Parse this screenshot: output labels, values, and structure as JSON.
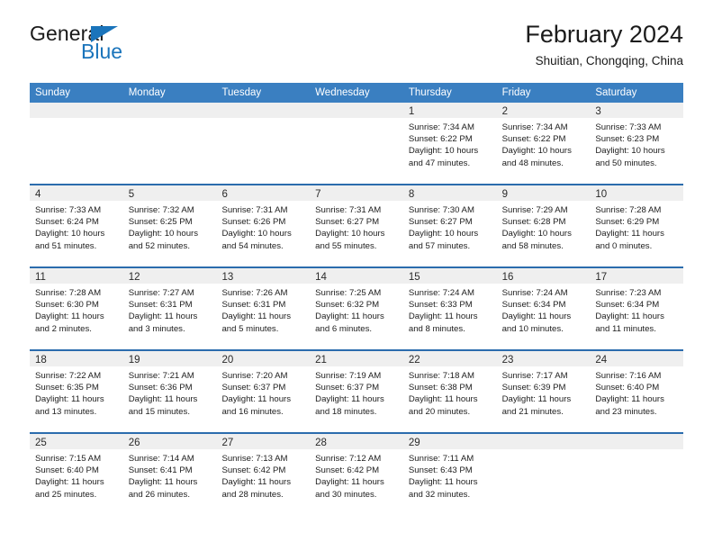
{
  "brand": {
    "name_top": "General",
    "name_bottom": "Blue",
    "triangle_color": "#1a74bb",
    "text_color": "#1a1a1a"
  },
  "header": {
    "title": "February 2024",
    "subtitle": "Shuitian, Chongqing, China"
  },
  "theme": {
    "header_blue": "#3a7fc1",
    "row_border_blue": "#2b6cad",
    "day_band_gray": "#efefef",
    "text_dark": "#1d1d1d"
  },
  "weekdays": [
    "Sunday",
    "Monday",
    "Tuesday",
    "Wednesday",
    "Thursday",
    "Friday",
    "Saturday"
  ],
  "weeks": [
    [
      {
        "day": "",
        "sunrise": "",
        "sunset": "",
        "daylight": "",
        "daylight2": ""
      },
      {
        "day": "",
        "sunrise": "",
        "sunset": "",
        "daylight": "",
        "daylight2": ""
      },
      {
        "day": "",
        "sunrise": "",
        "sunset": "",
        "daylight": "",
        "daylight2": ""
      },
      {
        "day": "",
        "sunrise": "",
        "sunset": "",
        "daylight": "",
        "daylight2": ""
      },
      {
        "day": "1",
        "sunrise": "Sunrise: 7:34 AM",
        "sunset": "Sunset: 6:22 PM",
        "daylight": "Daylight: 10 hours",
        "daylight2": "and 47 minutes."
      },
      {
        "day": "2",
        "sunrise": "Sunrise: 7:34 AM",
        "sunset": "Sunset: 6:22 PM",
        "daylight": "Daylight: 10 hours",
        "daylight2": "and 48 minutes."
      },
      {
        "day": "3",
        "sunrise": "Sunrise: 7:33 AM",
        "sunset": "Sunset: 6:23 PM",
        "daylight": "Daylight: 10 hours",
        "daylight2": "and 50 minutes."
      }
    ],
    [
      {
        "day": "4",
        "sunrise": "Sunrise: 7:33 AM",
        "sunset": "Sunset: 6:24 PM",
        "daylight": "Daylight: 10 hours",
        "daylight2": "and 51 minutes."
      },
      {
        "day": "5",
        "sunrise": "Sunrise: 7:32 AM",
        "sunset": "Sunset: 6:25 PM",
        "daylight": "Daylight: 10 hours",
        "daylight2": "and 52 minutes."
      },
      {
        "day": "6",
        "sunrise": "Sunrise: 7:31 AM",
        "sunset": "Sunset: 6:26 PM",
        "daylight": "Daylight: 10 hours",
        "daylight2": "and 54 minutes."
      },
      {
        "day": "7",
        "sunrise": "Sunrise: 7:31 AM",
        "sunset": "Sunset: 6:27 PM",
        "daylight": "Daylight: 10 hours",
        "daylight2": "and 55 minutes."
      },
      {
        "day": "8",
        "sunrise": "Sunrise: 7:30 AM",
        "sunset": "Sunset: 6:27 PM",
        "daylight": "Daylight: 10 hours",
        "daylight2": "and 57 minutes."
      },
      {
        "day": "9",
        "sunrise": "Sunrise: 7:29 AM",
        "sunset": "Sunset: 6:28 PM",
        "daylight": "Daylight: 10 hours",
        "daylight2": "and 58 minutes."
      },
      {
        "day": "10",
        "sunrise": "Sunrise: 7:28 AM",
        "sunset": "Sunset: 6:29 PM",
        "daylight": "Daylight: 11 hours",
        "daylight2": "and 0 minutes."
      }
    ],
    [
      {
        "day": "11",
        "sunrise": "Sunrise: 7:28 AM",
        "sunset": "Sunset: 6:30 PM",
        "daylight": "Daylight: 11 hours",
        "daylight2": "and 2 minutes."
      },
      {
        "day": "12",
        "sunrise": "Sunrise: 7:27 AM",
        "sunset": "Sunset: 6:31 PM",
        "daylight": "Daylight: 11 hours",
        "daylight2": "and 3 minutes."
      },
      {
        "day": "13",
        "sunrise": "Sunrise: 7:26 AM",
        "sunset": "Sunset: 6:31 PM",
        "daylight": "Daylight: 11 hours",
        "daylight2": "and 5 minutes."
      },
      {
        "day": "14",
        "sunrise": "Sunrise: 7:25 AM",
        "sunset": "Sunset: 6:32 PM",
        "daylight": "Daylight: 11 hours",
        "daylight2": "and 6 minutes."
      },
      {
        "day": "15",
        "sunrise": "Sunrise: 7:24 AM",
        "sunset": "Sunset: 6:33 PM",
        "daylight": "Daylight: 11 hours",
        "daylight2": "and 8 minutes."
      },
      {
        "day": "16",
        "sunrise": "Sunrise: 7:24 AM",
        "sunset": "Sunset: 6:34 PM",
        "daylight": "Daylight: 11 hours",
        "daylight2": "and 10 minutes."
      },
      {
        "day": "17",
        "sunrise": "Sunrise: 7:23 AM",
        "sunset": "Sunset: 6:34 PM",
        "daylight": "Daylight: 11 hours",
        "daylight2": "and 11 minutes."
      }
    ],
    [
      {
        "day": "18",
        "sunrise": "Sunrise: 7:22 AM",
        "sunset": "Sunset: 6:35 PM",
        "daylight": "Daylight: 11 hours",
        "daylight2": "and 13 minutes."
      },
      {
        "day": "19",
        "sunrise": "Sunrise: 7:21 AM",
        "sunset": "Sunset: 6:36 PM",
        "daylight": "Daylight: 11 hours",
        "daylight2": "and 15 minutes."
      },
      {
        "day": "20",
        "sunrise": "Sunrise: 7:20 AM",
        "sunset": "Sunset: 6:37 PM",
        "daylight": "Daylight: 11 hours",
        "daylight2": "and 16 minutes."
      },
      {
        "day": "21",
        "sunrise": "Sunrise: 7:19 AM",
        "sunset": "Sunset: 6:37 PM",
        "daylight": "Daylight: 11 hours",
        "daylight2": "and 18 minutes."
      },
      {
        "day": "22",
        "sunrise": "Sunrise: 7:18 AM",
        "sunset": "Sunset: 6:38 PM",
        "daylight": "Daylight: 11 hours",
        "daylight2": "and 20 minutes."
      },
      {
        "day": "23",
        "sunrise": "Sunrise: 7:17 AM",
        "sunset": "Sunset: 6:39 PM",
        "daylight": "Daylight: 11 hours",
        "daylight2": "and 21 minutes."
      },
      {
        "day": "24",
        "sunrise": "Sunrise: 7:16 AM",
        "sunset": "Sunset: 6:40 PM",
        "daylight": "Daylight: 11 hours",
        "daylight2": "and 23 minutes."
      }
    ],
    [
      {
        "day": "25",
        "sunrise": "Sunrise: 7:15 AM",
        "sunset": "Sunset: 6:40 PM",
        "daylight": "Daylight: 11 hours",
        "daylight2": "and 25 minutes."
      },
      {
        "day": "26",
        "sunrise": "Sunrise: 7:14 AM",
        "sunset": "Sunset: 6:41 PM",
        "daylight": "Daylight: 11 hours",
        "daylight2": "and 26 minutes."
      },
      {
        "day": "27",
        "sunrise": "Sunrise: 7:13 AM",
        "sunset": "Sunset: 6:42 PM",
        "daylight": "Daylight: 11 hours",
        "daylight2": "and 28 minutes."
      },
      {
        "day": "28",
        "sunrise": "Sunrise: 7:12 AM",
        "sunset": "Sunset: 6:42 PM",
        "daylight": "Daylight: 11 hours",
        "daylight2": "and 30 minutes."
      },
      {
        "day": "29",
        "sunrise": "Sunrise: 7:11 AM",
        "sunset": "Sunset: 6:43 PM",
        "daylight": "Daylight: 11 hours",
        "daylight2": "and 32 minutes."
      },
      {
        "day": "",
        "sunrise": "",
        "sunset": "",
        "daylight": "",
        "daylight2": ""
      },
      {
        "day": "",
        "sunrise": "",
        "sunset": "",
        "daylight": "",
        "daylight2": ""
      }
    ]
  ]
}
